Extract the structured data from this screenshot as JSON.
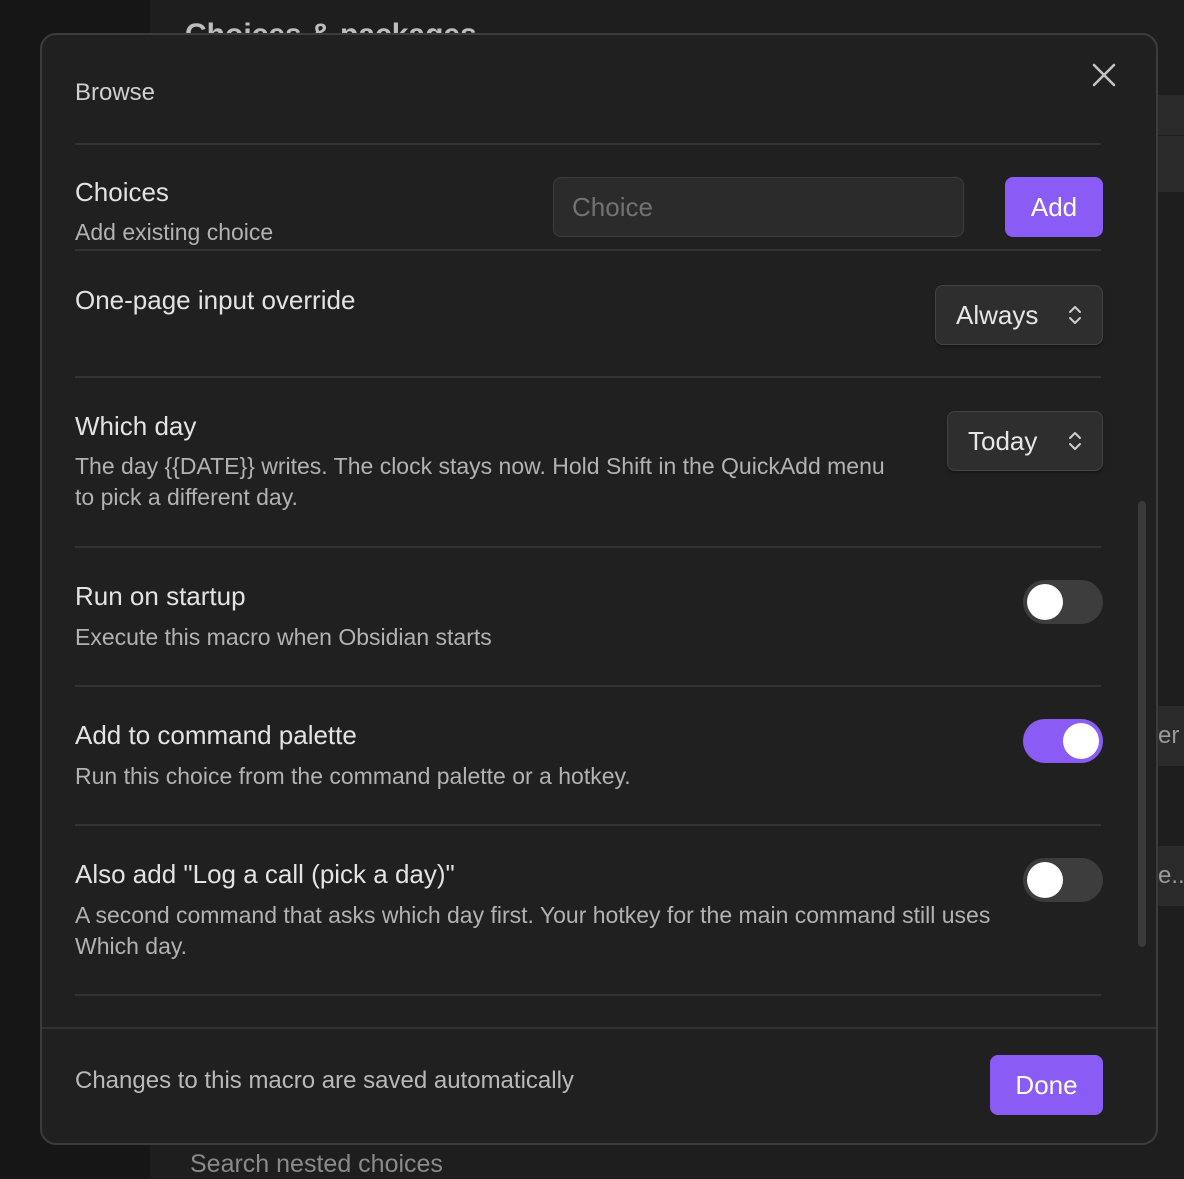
{
  "background": {
    "heading": "Choices & packages",
    "side_fragment_1": "er",
    "side_fragment_2": "e...",
    "search_placeholder": "Search nested choices"
  },
  "modal": {
    "section_label": "Browse",
    "close_icon": "close-icon",
    "choices": {
      "title": "Choices",
      "desc": "Add existing choice",
      "input_placeholder": "Choice",
      "input_value": "",
      "add_label": "Add"
    },
    "one_page": {
      "title": "One-page input override",
      "selected": "Always"
    },
    "which_day": {
      "title": "Which day",
      "desc": "The day {{DATE}} writes. The clock stays now. Hold Shift in the QuickAdd menu to pick a different day.",
      "selected": "Today"
    },
    "run_on_startup": {
      "title": "Run on startup",
      "desc": "Execute this macro when Obsidian starts",
      "enabled": false
    },
    "command_palette": {
      "title": "Add to command palette",
      "desc": "Run this choice from the command palette or a hotkey.",
      "enabled": true
    },
    "pick_a_day": {
      "title": "Also add \"Log a call (pick a day)\"",
      "desc": "A second command that asks which day first. Your hotkey for the main command still uses Which day.",
      "enabled": false
    },
    "footer": {
      "text": "Changes to this macro are saved automatically",
      "done_label": "Done"
    }
  },
  "colors": {
    "accent": "#8a5cf5",
    "modal_bg": "#202020",
    "toggle_off": "#3d3d3d"
  }
}
